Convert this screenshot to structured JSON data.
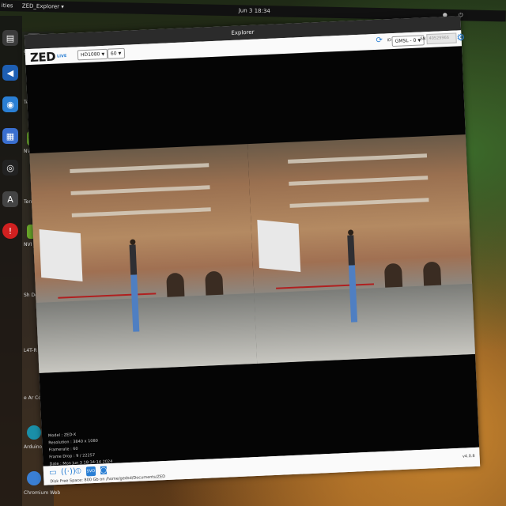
{
  "desktop": {
    "activities": "ities",
    "app_menu": "ZED_Explorer ▾",
    "clock": "Jun 3  18:34",
    "tray": "●  ⏻",
    "desktop_labels": [
      "gedit",
      "Ter",
      "NVI Jets",
      "Term",
      "NVI Jets Foru",
      "Sh Dev",
      "L4T-R",
      "e Ar Commu",
      "Arduino ID",
      "Chromium Web"
    ]
  },
  "window": {
    "title": "Explorer",
    "logo": "ZED",
    "live_badge": "LIVE",
    "resolution": "HD1080",
    "fps": "60",
    "id_label": "ID",
    "id_value": "GMSL - 0",
    "sn_label": "SN",
    "sn_placeholder": "40529966"
  },
  "info": {
    "model": "Model : ZED-X",
    "resolution": "Resolution : 3840 x 1080",
    "framerate": "Framerate : 60",
    "frame_drop": "Frame Drop : 9 / 22257",
    "date": "Date : Mon Jun 3 18:34:14 2024"
  },
  "footer": {
    "disk_space": "Disk Free Space: 800 Gb  on /home/gedsd/Documents/ZED",
    "version": "v4.0.8"
  },
  "icons": {
    "accent": "#2a7fd4"
  }
}
